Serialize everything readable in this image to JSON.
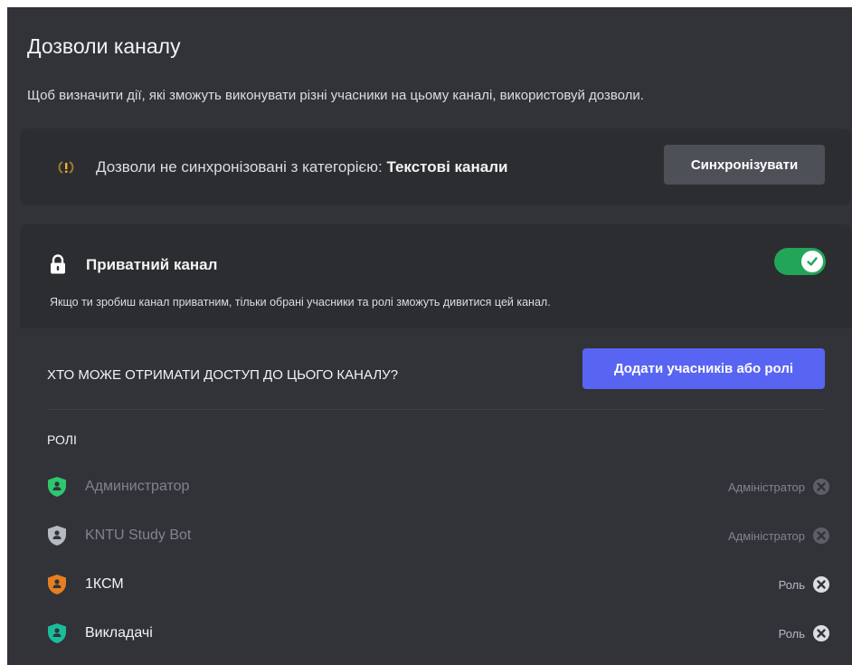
{
  "page": {
    "title": "Дозволи каналу",
    "description": "Щоб визначити дії, які зможуть виконувати різні учасники на цьому каналі, використовуй дозволи."
  },
  "sync": {
    "icon": "sync-warning-icon",
    "text_prefix": "Дозволи не синхронізовані з категорією: ",
    "category": "Текстові канали",
    "button_label": "Синхронізувати"
  },
  "private_channel": {
    "icon": "lock-icon",
    "title": "Приватний канал",
    "description": "Якщо ти зробиш канал приватним, тільки обрані учасники та ролі зможуть дивитися цей канал.",
    "enabled": true
  },
  "access": {
    "label": "ХТО МОЖЕ ОТРИМАТИ ДОСТУП ДО ЦЬОГО КАНАЛУ?",
    "add_button_label": "Додати учасників або ролі"
  },
  "roles": {
    "header": "РОЛІ",
    "items": [
      {
        "name": "Администратор",
        "type": "Адміністратор",
        "color": "#2dc770",
        "removable": false
      },
      {
        "name": "KNTU Study Bot",
        "type": "Адміністратор",
        "color": "#b5bac1",
        "removable": false
      },
      {
        "name": "1КСМ",
        "type": "Роль",
        "color": "#e67e22",
        "removable": true
      },
      {
        "name": "Викладачі",
        "type": "Роль",
        "color": "#1abc9c",
        "removable": true
      }
    ]
  },
  "colors": {
    "background": "#313338",
    "card": "#2b2d31",
    "accent": "#5865f2",
    "toggle_on": "#23a559"
  }
}
